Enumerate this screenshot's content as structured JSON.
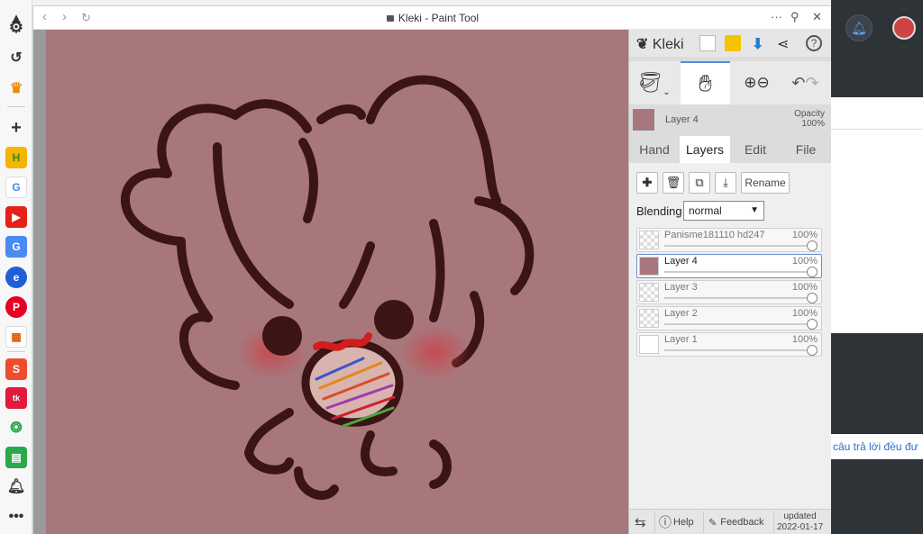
{
  "window": {
    "title": "Kleki - Paint Tool"
  },
  "panel": {
    "brand": "Kleki",
    "current_layer": {
      "name": "Layer 4",
      "opacity_label": "Opacity",
      "opacity_value": "100%"
    },
    "tabs": [
      {
        "label": "Hand"
      },
      {
        "label": "Layers"
      },
      {
        "label": "Edit"
      },
      {
        "label": "File"
      }
    ],
    "layers_tab": {
      "rename_label": "Rename",
      "blending_label": "Blending",
      "blending_value": "normal",
      "layers": [
        {
          "name": "Panisme181110 hd247",
          "opacity": "100%"
        },
        {
          "name": "Layer 4",
          "opacity": "100%"
        },
        {
          "name": "Layer 3",
          "opacity": "100%"
        },
        {
          "name": "Layer 2",
          "opacity": "100%"
        },
        {
          "name": "Layer 1",
          "opacity": "100%"
        }
      ]
    },
    "footer": {
      "help": "Help",
      "feedback": "Feedback",
      "updated_label": "updated",
      "updated_date": "2022-01-17"
    }
  },
  "background_page": {
    "snippet": "câu trả lời đều đư"
  },
  "colors": {
    "canvas": "#a7777b",
    "stroke": "#3b1414",
    "accent": "#1d7fd6"
  }
}
